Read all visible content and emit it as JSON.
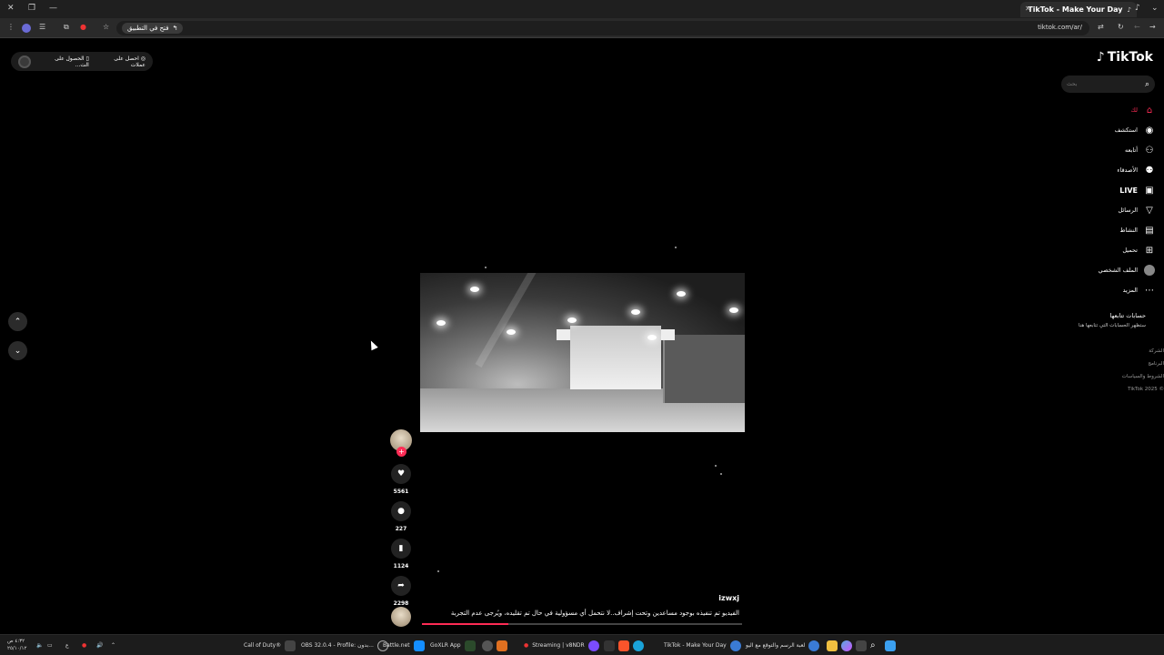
{
  "browser": {
    "tab_title": "TikTok - Make Your Day",
    "url": "tiktok.com/ar/",
    "open_in_app": "فتح في التطبيق"
  },
  "promo": {
    "get_points": "احصل على عملات",
    "get_app": "الحصول على الت..."
  },
  "sidebar": {
    "logo": "TikTok",
    "search_placeholder": "بحث",
    "items": [
      {
        "label": "لك",
        "icon": "home-icon",
        "active": true
      },
      {
        "label": "استكشف",
        "icon": "compass-icon"
      },
      {
        "label": "أتابعه",
        "icon": "following-icon"
      },
      {
        "label": "الأصدقاء",
        "icon": "friends-icon"
      },
      {
        "label": "LIVE",
        "icon": "live-icon"
      },
      {
        "label": "الرسائل",
        "icon": "messages-icon"
      },
      {
        "label": "النشاط",
        "icon": "activity-icon"
      },
      {
        "label": "تحميل",
        "icon": "upload-icon"
      },
      {
        "label": "الملف الشخصي",
        "icon": "profile-avatar-icon"
      },
      {
        "label": "المزيد",
        "icon": "more-icon"
      }
    ],
    "following_header": "حسابات تتابعها",
    "following_sub": "ستظهر الحسابات التي تتابعها هنا",
    "footer": [
      "الشركة",
      "البرنامج",
      "الشروط والسياسات",
      "TikTok 2025 ©"
    ]
  },
  "video": {
    "author": "izwxj",
    "caption": "الفيديو تم تنفيذه بوجود مساعدين وتحت إشراف..لا نتحمل أي مسؤولية في حال تم تقليده، ويُرجى عدم التجربة",
    "likes": "5561",
    "comments": "227",
    "saves": "1124",
    "shares": "2298",
    "progress": 0.27
  },
  "taskbar": {
    "items": [
      "Call of Duty®",
      "OBS 32.0.4 - Profile: بدون...",
      "Battle.net",
      "GoXLR App",
      "Streaming | v8NDR",
      "TikTok - Make Your Day",
      "لعبة الرسم والتوقع مع اليو"
    ],
    "time": "٤:٣٢ ص",
    "date": "٢٥/١٠/١٢"
  },
  "colors": {
    "accent": "#fe2c55",
    "background": "#000000"
  }
}
